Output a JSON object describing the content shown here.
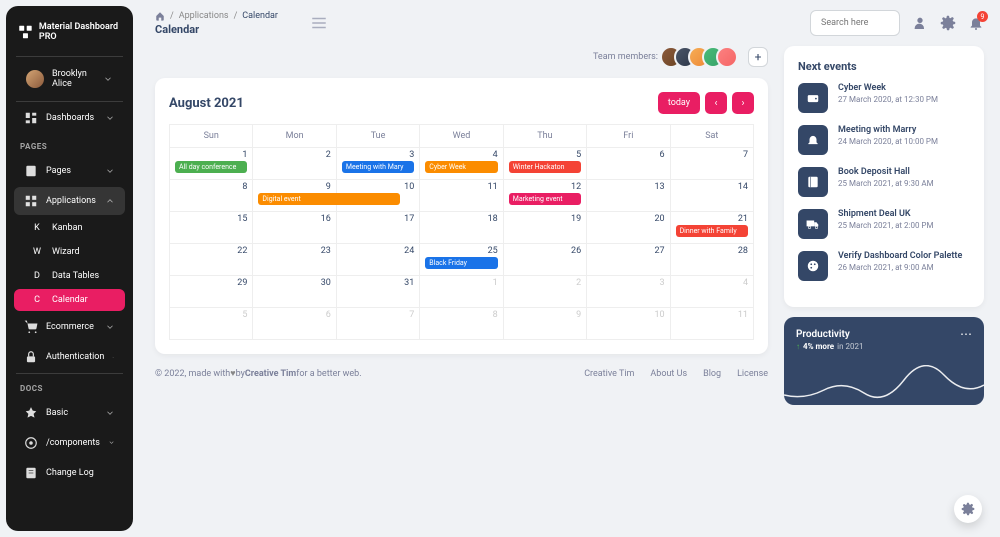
{
  "brand": "Material Dashboard PRO",
  "user": {
    "name": "Brooklyn Alice"
  },
  "sections": {
    "pages": "PAGES",
    "docs": "DOCS"
  },
  "sidebar": {
    "dashboards": "Dashboards",
    "pages": "Pages",
    "applications": "Applications",
    "subs": {
      "kanban": {
        "letter": "K",
        "label": "Kanban"
      },
      "wizard": {
        "letter": "W",
        "label": "Wizard"
      },
      "datatables": {
        "letter": "D",
        "label": "Data Tables"
      },
      "calendar": {
        "letter": "C",
        "label": "Calendar"
      }
    },
    "ecommerce": "Ecommerce",
    "authentication": "Authentication",
    "basic": "Basic",
    "components": "/components",
    "changelog": "Change Log"
  },
  "breadcrumb": {
    "applications": "Applications",
    "current": "Calendar",
    "title": "Calendar"
  },
  "search": {
    "placeholder": "Search here"
  },
  "notifications": {
    "count": "9"
  },
  "team": {
    "label": "Team members:"
  },
  "calendar": {
    "title": "August 2021",
    "today": "today",
    "days": [
      "Sun",
      "Mon",
      "Tue",
      "Wed",
      "Thu",
      "Fri",
      "Sat"
    ],
    "cells": [
      {
        "n": "1"
      },
      {
        "n": "2"
      },
      {
        "n": "3"
      },
      {
        "n": "4"
      },
      {
        "n": "5"
      },
      {
        "n": "6"
      },
      {
        "n": "7"
      },
      {
        "n": "8"
      },
      {
        "n": "9"
      },
      {
        "n": "10"
      },
      {
        "n": "11"
      },
      {
        "n": "12"
      },
      {
        "n": "13"
      },
      {
        "n": "14"
      },
      {
        "n": "15"
      },
      {
        "n": "16"
      },
      {
        "n": "17"
      },
      {
        "n": "18"
      },
      {
        "n": "19"
      },
      {
        "n": "20"
      },
      {
        "n": "21"
      },
      {
        "n": "22"
      },
      {
        "n": "23"
      },
      {
        "n": "24"
      },
      {
        "n": "25"
      },
      {
        "n": "26"
      },
      {
        "n": "27"
      },
      {
        "n": "28"
      },
      {
        "n": "29"
      },
      {
        "n": "30"
      },
      {
        "n": "31"
      },
      {
        "n": "1",
        "muted": true
      },
      {
        "n": "2",
        "muted": true
      },
      {
        "n": "3",
        "muted": true
      },
      {
        "n": "4",
        "muted": true
      },
      {
        "n": "5",
        "muted": true
      },
      {
        "n": "6",
        "muted": true
      },
      {
        "n": "7",
        "muted": true
      },
      {
        "n": "8",
        "muted": true
      },
      {
        "n": "9",
        "muted": true
      },
      {
        "n": "10",
        "muted": true
      },
      {
        "n": "11",
        "muted": true
      }
    ],
    "events": {
      "allday": "All day conference",
      "meeting": "Meeting with Mary",
      "cyber": "Cyber Week",
      "winter": "Winter Hackaton",
      "digital": "Digital event",
      "marketing": "Marketing event",
      "dinner": "Dinner with Family",
      "black": "Black Friday"
    }
  },
  "nextEvents": {
    "title": "Next events",
    "items": [
      {
        "title": "Cyber Week",
        "date": "27 March 2020, at 12:30 PM",
        "icon": "wallet"
      },
      {
        "title": "Meeting with Marry",
        "date": "24 March 2020, at 10:00 PM",
        "icon": "bell"
      },
      {
        "title": "Book Deposit Hall",
        "date": "25 March 2021, at 9:30 AM",
        "icon": "book"
      },
      {
        "title": "Shipment Deal UK",
        "date": "25 March 2021, at 2:00 PM",
        "icon": "truck"
      },
      {
        "title": "Verify Dashboard Color Palette",
        "date": "26 March 2021, at 9:00 AM",
        "icon": "palette"
      }
    ]
  },
  "productivity": {
    "title": "Productivity",
    "pct": "4% more",
    "year": "in 2021"
  },
  "footer": {
    "copyright": "© 2022, made with ",
    "by": " by ",
    "author": "Creative Tim",
    "tagline": " for a better web.",
    "links": [
      "Creative Tim",
      "About Us",
      "Blog",
      "License"
    ]
  }
}
